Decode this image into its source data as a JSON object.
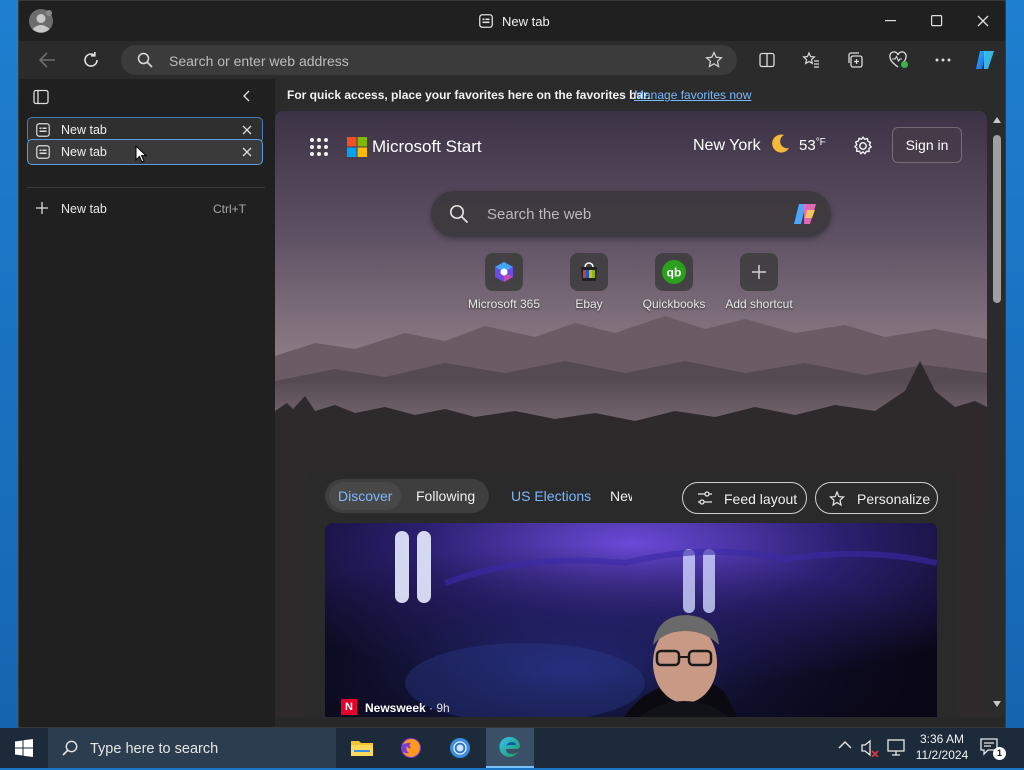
{
  "window": {
    "title": "New tab"
  },
  "toolbar": {
    "address_placeholder": "Search or enter web address"
  },
  "sidebar": {
    "tabs": [
      {
        "label": "New tab"
      },
      {
        "label": "New tab"
      }
    ],
    "new_tab": {
      "label": "New tab",
      "shortcut": "Ctrl+T"
    }
  },
  "favorites_bar": {
    "message": "For quick access, place your favorites here on the favorites bar.",
    "link": "Manage favorites now"
  },
  "ntp": {
    "brand": "Microsoft Start",
    "weather": {
      "city": "New York",
      "temp": "53",
      "unit": "°F"
    },
    "sign_in": "Sign in",
    "search_placeholder": "Search the web",
    "shortcuts": [
      {
        "label": "Microsoft 365"
      },
      {
        "label": "Ebay"
      },
      {
        "label": "Quickbooks"
      },
      {
        "label": "Add shortcut"
      }
    ],
    "feed_tabs": {
      "discover": "Discover",
      "following": "Following",
      "elections": "US Elections",
      "news": "New"
    },
    "feed_layout": "Feed layout",
    "personalize": "Personalize",
    "article": {
      "source": "Newsweek",
      "age": "· 9h"
    }
  },
  "taskbar": {
    "search_placeholder": "Type here to search",
    "time": "3:36 AM",
    "date": "11/2/2024",
    "notification_count": "1"
  },
  "colors": {
    "accent": "#4ea3e8",
    "link": "#7ab8ff",
    "taskbar": "#1c2a3a"
  }
}
